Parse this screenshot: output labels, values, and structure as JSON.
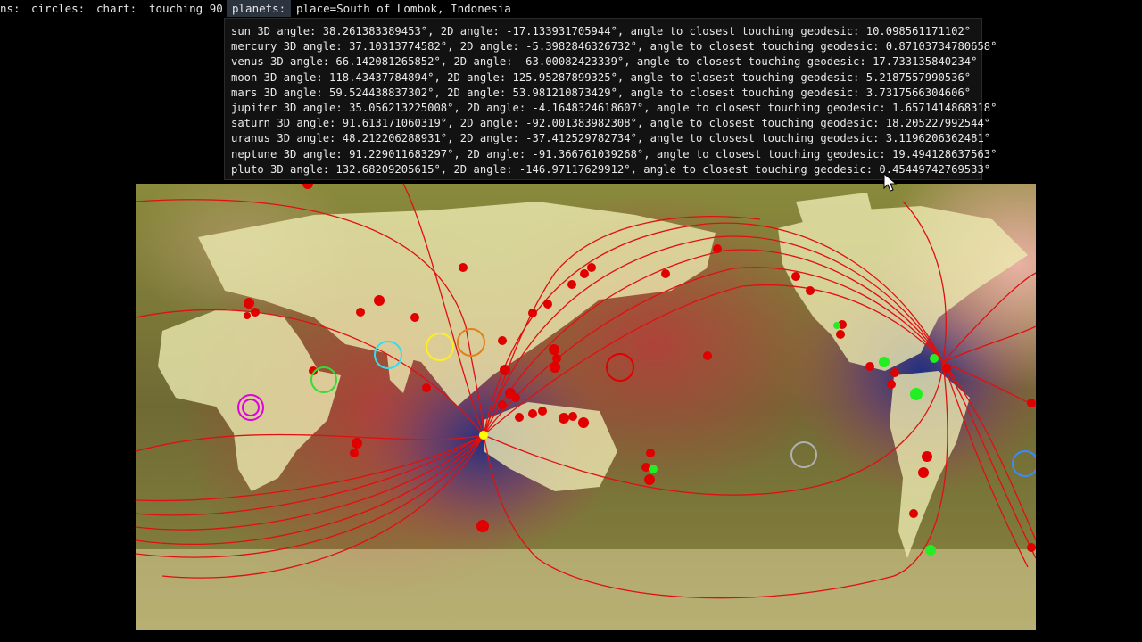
{
  "menu": {
    "items": [
      {
        "label": "ns:"
      },
      {
        "label": "circles:"
      },
      {
        "label": "chart:"
      },
      {
        "label": "touching 90"
      },
      {
        "label": "planets:"
      }
    ],
    "place": "place=South of Lombok, Indonesia"
  },
  "planets": [
    {
      "text": "sun 3D angle: 38.261383389453°, 2D angle: -17.133931705944°, angle to closest touching geodesic: 10.098561171102°"
    },
    {
      "text": "mercury 3D angle: 37.10313774582°, 2D angle: -5.3982846326732°, angle to closest touching geodesic: 0.87103734780658°"
    },
    {
      "text": "venus 3D angle: 66.142081265852°, 2D angle: -63.00082423339°, angle to closest touching geodesic: 17.733135840234°"
    },
    {
      "text": "moon 3D angle: 118.43437784894°, 2D angle: 125.95287899325°, angle to closest touching geodesic: 5.2187557990536°"
    },
    {
      "text": "mars 3D angle: 59.524438837302°, 2D angle: 53.981210873429°, angle to closest touching geodesic: 3.7317566304606°"
    },
    {
      "text": "jupiter 3D angle: 35.056213225008°, 2D angle: -4.1648324618607°, angle to closest touching geodesic: 1.6571414868318°"
    },
    {
      "text": "saturn 3D angle: 91.613171060319°, 2D angle: -92.001383982308°, angle to closest touching geodesic: 18.205227992544°"
    },
    {
      "text": "uranus 3D angle: 48.212206288931°, 2D angle: -37.412529782734°, angle to closest touching geodesic: 3.1196206362481°"
    },
    {
      "text": "neptune 3D angle: 91.229011683297°, 2D angle: -91.366761039268°, angle to closest touching geodesic: 19.494128637563°"
    },
    {
      "text": "pluto 3D angle: 132.68209205615°, 2D angle: -146.97117629912°, angle to closest touching geodesic: 0.45449742769533°"
    }
  ],
  "colors": {
    "geodesic": "#e01010",
    "place_marker": "#ffff00",
    "ocean_dark": "#2a3a78",
    "ocean_warm": "#c05a4a",
    "land": "#e8e6a0"
  },
  "map": {
    "icon": "world-map-equirectangular",
    "planet_marker_colors": [
      "#ffff00",
      "#ff8c00",
      "#ffff44",
      "#00ffff",
      "#ff0000",
      "#ff4500",
      "#c0c0c0",
      "#1e90ff",
      "#4169e1",
      "#00ff00",
      "#ff00ff"
    ]
  }
}
